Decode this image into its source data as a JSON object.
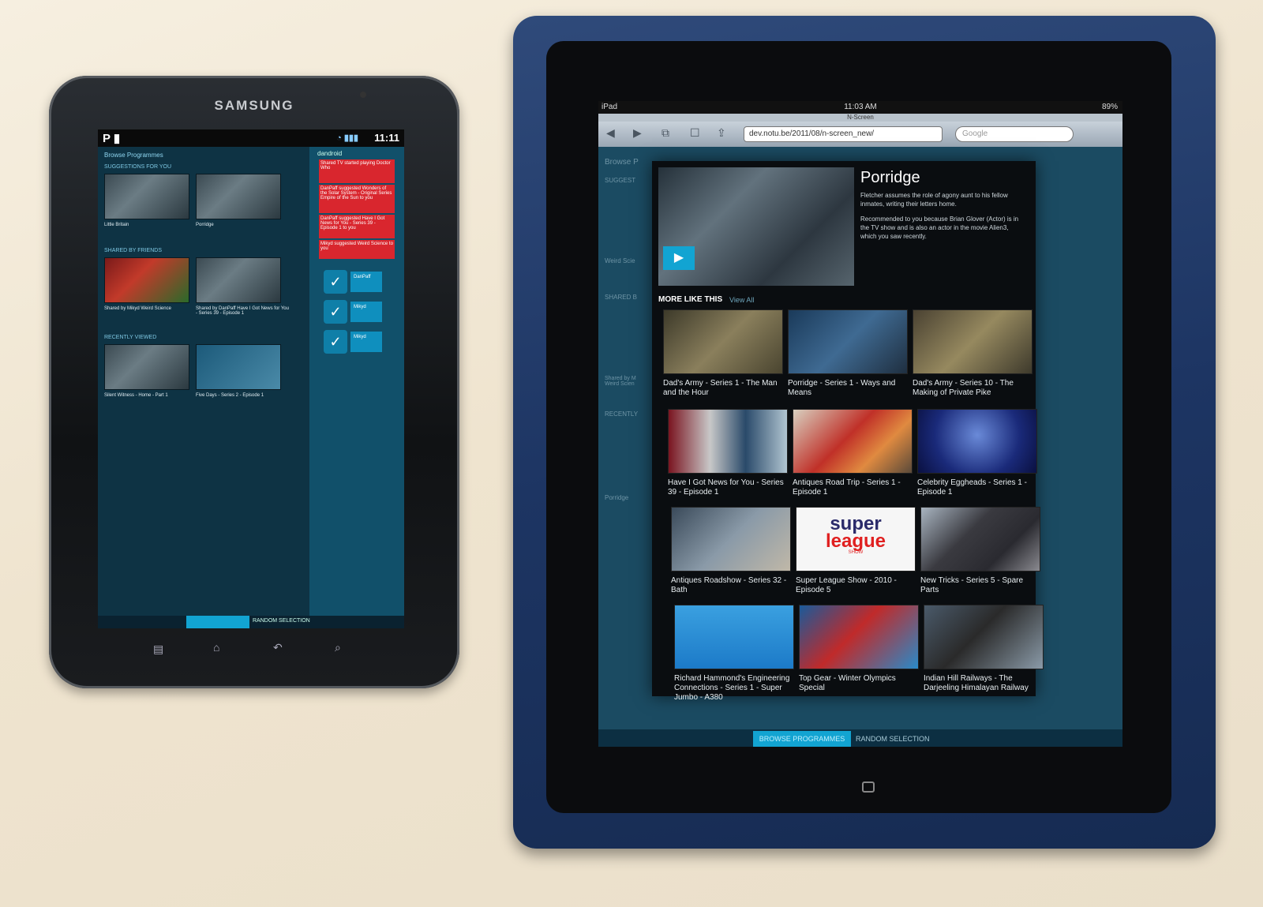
{
  "samsung": {
    "brand": "SAMSUNG",
    "status_time": "11:11",
    "header_title": "Browse Programmes",
    "sections": [
      {
        "title": "SUGGESTIONS FOR YOU",
        "items": [
          "Little Britain",
          "Porridge"
        ]
      },
      {
        "title": "SHARED BY FRIENDS",
        "items": [
          "Shared by Mikyd Weird Science",
          "Shared by DanPaff Have I Got News for You - Series 39 - Episode 1"
        ]
      },
      {
        "title": "RECENTLY VIEWED",
        "items": [
          "Silent Witness - Home - Part 1",
          "Five Days - Series 2 - Episode 1"
        ]
      }
    ],
    "side_title": "dandroid",
    "notifications": [
      "Shared TV started playing Doctor Who",
      "DanPaff suggested Wonders of the Solar System - Original Series Empire of the Sun to you",
      "DanPaff suggested Have I Got News for You - Series 39 - Episode 1 to you",
      "Mikyd suggested Weird Science to you"
    ],
    "friends": [
      "DanPaff",
      "Mikyd",
      "Mikyd"
    ],
    "bottom_label": "RANDOM SELECTION"
  },
  "ipad": {
    "carrier": "iPad",
    "time": "11:03 AM",
    "battery": "89%",
    "page_title": "N-Screen",
    "url": "dev.notu.be/2011/08/n-screen_new/",
    "search_placeholder": "Google",
    "bg_labels": [
      "Browse P",
      "SUGGEST",
      "Weird Scie",
      "SHARED B",
      "Shared by M Weird Scien",
      "RECENTLY",
      "Porridge"
    ],
    "modal": {
      "title": "Porridge",
      "description": "Fletcher assumes the role of agony aunt to his fellow inmates, writing their letters home.",
      "recommendation": "Recommended to you because Brian Glover (Actor) is in the TV show and is also an actor in the movie Alien3, which you saw recently.",
      "more_label": "MORE LIKE THIS",
      "view_all": "View All",
      "grid": [
        "Dad's Army - Series 1 - The Man and the Hour",
        "Porridge - Series 1 - Ways and Means",
        "Dad's Army - Series 10 - The Making of Private Pike",
        "Have I Got News for You - Series 39 - Episode 1",
        "Antiques Road Trip - Series 1 - Episode 1",
        "Celebrity Eggheads - Series 1 - Episode 1",
        "Antiques Roadshow - Series 32 - Bath",
        "Super League Show - 2010 - Episode 5",
        "New Tricks - Series 5 - Spare Parts",
        "Richard Hammond's Engineering Connections - Series 1 - Super Jumbo - A380",
        "Top Gear - Winter Olympics Special",
        "Indian Hill Railways - The Darjeeling Himalayan Railway"
      ],
      "super_league": {
        "line1": "super",
        "line2": "league",
        "line3": "SHOW"
      }
    },
    "tabs": [
      "BROWSE PROGRAMMES",
      "RANDOM SELECTION"
    ]
  }
}
